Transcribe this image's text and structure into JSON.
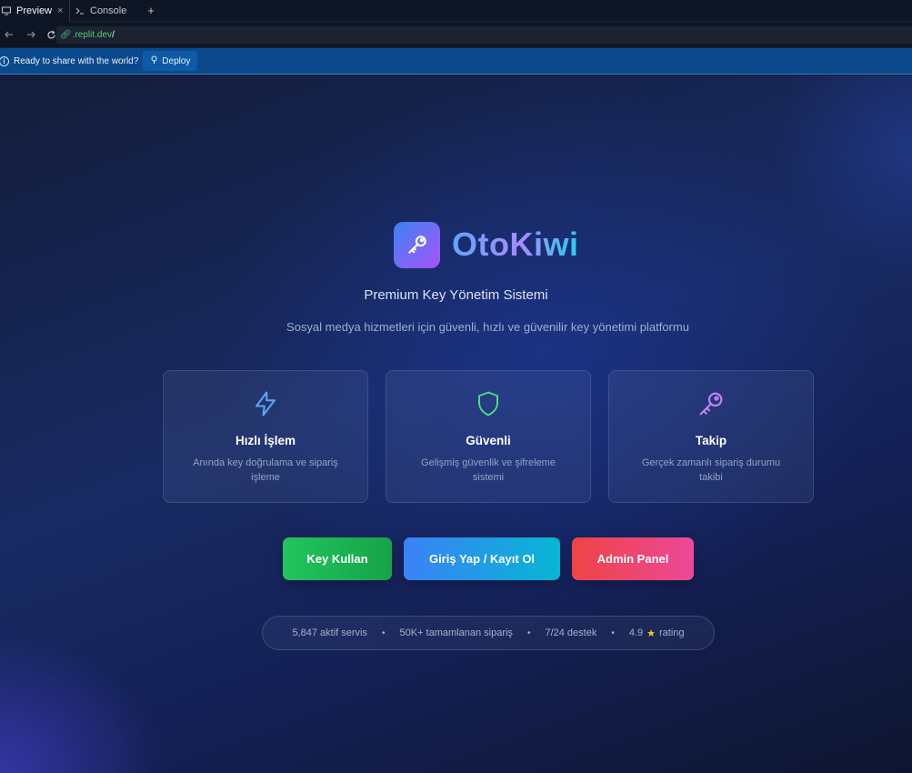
{
  "browser": {
    "tabs": [
      {
        "label": "Preview",
        "close": "×"
      },
      {
        "label": "Console"
      }
    ],
    "new_tab": "+",
    "url": {
      "host": ".replit.dev",
      "path": "/"
    },
    "deploy_bar": {
      "message": "Ready to share with the world?",
      "button": "Deploy"
    }
  },
  "app": {
    "brand": {
      "name_part1": "Oto",
      "name_part2": "Kiwi"
    },
    "subtitle": "Premium Key Yönetim Sistemi",
    "description": "Sosyal medya hizmetleri için güvenli, hızlı ve güvenilir key yönetimi platformu",
    "features": [
      {
        "icon": "lightning-icon",
        "title": "Hızlı İşlem",
        "text": "Anında key doğrulama ve sipariş işleme",
        "color": "#60a5fa"
      },
      {
        "icon": "shield-icon",
        "title": "Güvenli",
        "text": "Gelişmiş güvenlik ve şifreleme sistemi",
        "color": "#4ade80"
      },
      {
        "icon": "key-icon",
        "title": "Takip",
        "text": "Gerçek zamanlı sipariş durumu takibi",
        "color": "#c084fc"
      }
    ],
    "buttons": {
      "key": "Key Kullan",
      "login": "Giriş Yap / Kayıt Ol",
      "admin": "Admin Panel"
    },
    "stats": {
      "services": "5,847 aktif servis",
      "orders": "50K+ tamamlanan sipariş",
      "support": "7/24 destek",
      "rating_value": "4.9",
      "rating_label": "rating",
      "separator": "•"
    }
  }
}
